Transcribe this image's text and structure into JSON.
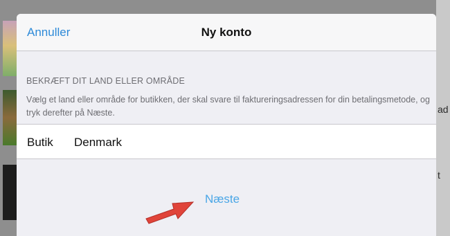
{
  "navbar": {
    "cancel_label": "Annuller",
    "title": "Ny konto"
  },
  "section": {
    "header": "BEKRÆFT DIT LAND ELLER OMRÅDE",
    "description": "Vælg et land eller område for butikken, der skal svare til faktureringsadressen for din betalingsmetode, og tryk derefter på Næste."
  },
  "store_row": {
    "label": "Butik",
    "value": "Denmark"
  },
  "next_label": "Næste",
  "background": {
    "partial_text_1": "ad",
    "partial_text_2": "t"
  },
  "colors": {
    "accent": "#2e8ad8",
    "annotation_arrow": "#e0443a"
  },
  "icons": {
    "annotation": "red-arrow-icon"
  }
}
